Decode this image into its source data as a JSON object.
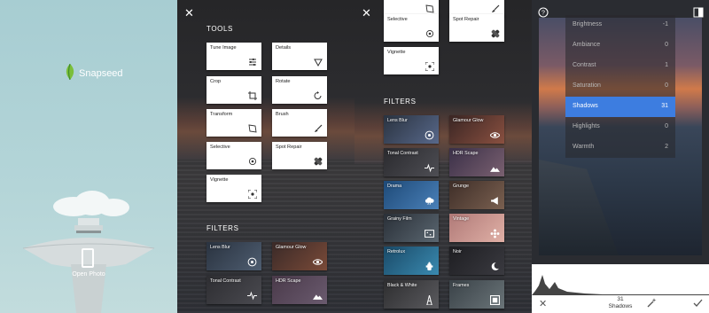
{
  "splash": {
    "app_name": "Snapseed",
    "open_photo_label": "Open Photo",
    "icons": [
      "snapseed-leaf-icon",
      "phone-icon"
    ]
  },
  "tools_panel": {
    "close_icon": "close-icon",
    "tools_title": "TOOLS",
    "tools": [
      {
        "label": "Tune Image",
        "icon": "sliders-icon"
      },
      {
        "label": "Details",
        "icon": "triangle-icon"
      },
      {
        "label": "Crop",
        "icon": "crop-icon"
      },
      {
        "label": "Rotate",
        "icon": "rotate-icon"
      },
      {
        "label": "Transform",
        "icon": "transform-icon"
      },
      {
        "label": "Brush",
        "icon": "brush-icon"
      },
      {
        "label": "Selective",
        "icon": "target-icon"
      },
      {
        "label": "Spot Repair",
        "icon": "bandage-icon"
      },
      {
        "label": "Vignette",
        "icon": "vignette-icon"
      }
    ],
    "filters_title": "FILTERS",
    "filters": [
      {
        "label": "Lens Blur",
        "icon": "target-icon"
      },
      {
        "label": "Glamour Glow",
        "icon": "eye-icon"
      },
      {
        "label": "Tonal Contrast",
        "icon": "pulse-icon"
      },
      {
        "label": "HDR Scape",
        "icon": "mountain-icon"
      }
    ]
  },
  "filters_panel": {
    "close_icon": "close-icon",
    "tools_visible": [
      {
        "label": "Selective",
        "icon": "target-icon"
      },
      {
        "label": "Spot Repair",
        "icon": "bandage-icon"
      },
      {
        "label": "Vignette",
        "icon": "vignette-icon"
      }
    ],
    "filters_title": "FILTERS",
    "filters": [
      {
        "label": "Lens Blur",
        "icon": "target-icon",
        "bg": "#4a5a72"
      },
      {
        "label": "Glamour Glow",
        "icon": "eye-icon",
        "bg": "#6a4038"
      },
      {
        "label": "Tonal Contrast",
        "icon": "pulse-icon",
        "bg": "#3a3a3e"
      },
      {
        "label": "HDR Scape",
        "icon": "mountain-icon",
        "bg": "#5a4a5a"
      },
      {
        "label": "Drama",
        "icon": "cloud-icon",
        "bg": "#3b6b9a"
      },
      {
        "label": "Grunge",
        "icon": "megaphone-icon",
        "bg": "#5e4a3e"
      },
      {
        "label": "Grainy Film",
        "icon": "film-icon",
        "bg": "#46505a"
      },
      {
        "label": "Vintage",
        "icon": "flower-icon",
        "bg": "#c8928a"
      },
      {
        "label": "Retrolux",
        "icon": "hydrant-icon",
        "bg": "#2e6a8a"
      },
      {
        "label": "Noir",
        "icon": "moon-icon",
        "bg": "#2c2c30"
      },
      {
        "label": "Black & White",
        "icon": "tower-icon",
        "bg": "#3c3c3e"
      },
      {
        "label": "Frames",
        "icon": "frame-icon",
        "bg": "#4a5258"
      }
    ]
  },
  "edit_panel": {
    "top_icons": [
      "help-icon",
      "compare-icon"
    ],
    "adjustments": [
      {
        "label": "Brightness",
        "value": "-1"
      },
      {
        "label": "Ambiance",
        "value": "0"
      },
      {
        "label": "Contrast",
        "value": "1"
      },
      {
        "label": "Saturation",
        "value": "0"
      },
      {
        "label": "Shadows",
        "value": "31",
        "active": true
      },
      {
        "label": "Highlights",
        "value": "0"
      },
      {
        "label": "Warmth",
        "value": "2"
      }
    ],
    "bottom": {
      "value": "31",
      "param": "Shadows",
      "icons": [
        "cancel-icon",
        "magic-wand-icon",
        "apply-check-icon"
      ]
    },
    "accent": "#3d7de0"
  }
}
